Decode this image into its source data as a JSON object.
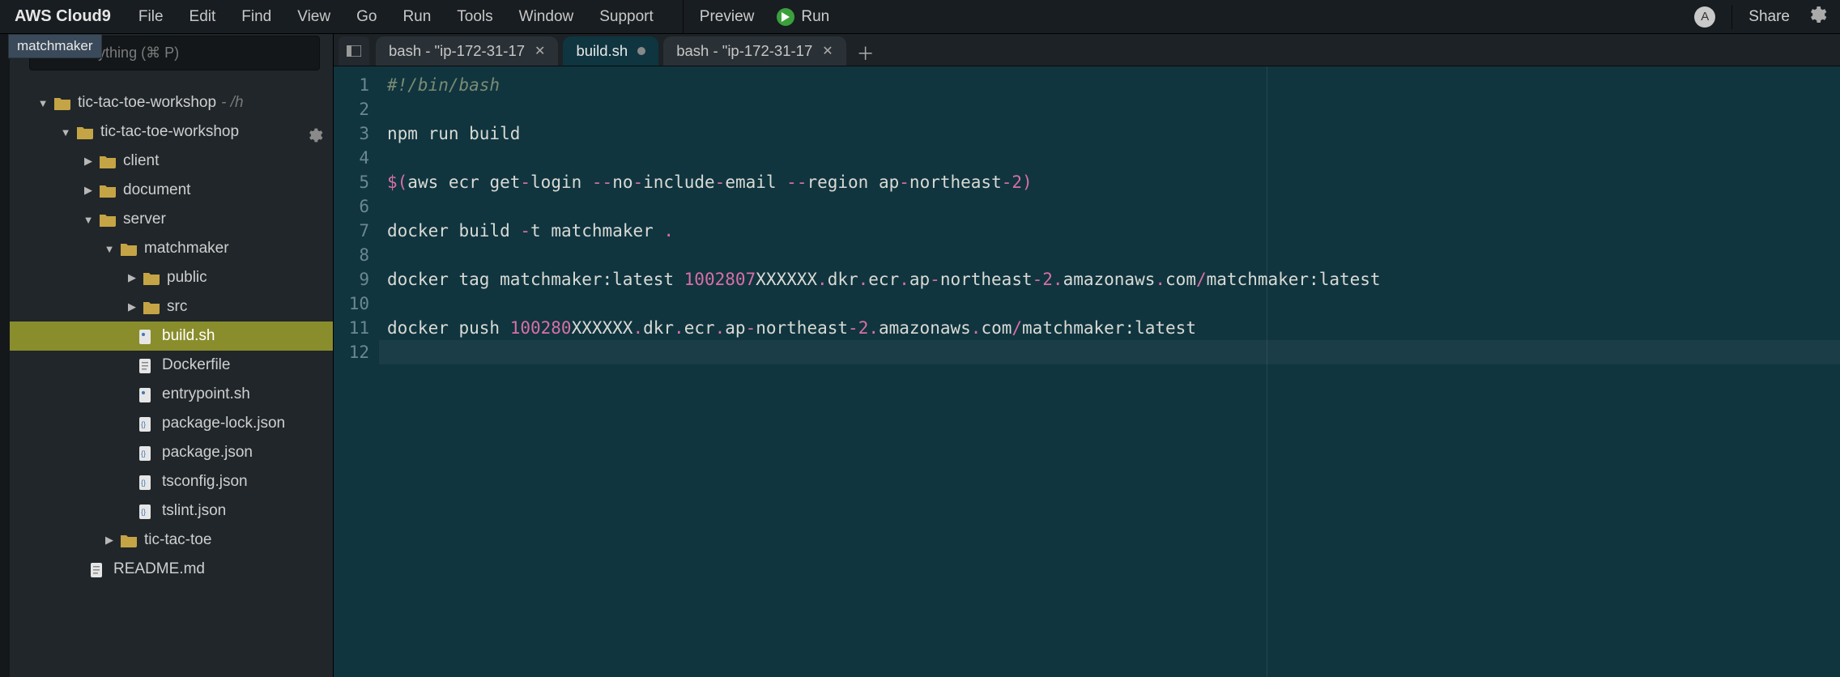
{
  "brand": "AWS Cloud9",
  "menu": [
    "File",
    "Edit",
    "Find",
    "View",
    "Go",
    "Run",
    "Tools",
    "Window",
    "Support"
  ],
  "preview_label": "Preview",
  "run_label": "Run",
  "avatar_letter": "A",
  "share_label": "Share",
  "tooltip": "matchmaker",
  "goto_placeholder": "Go to Anything (⌘ P)",
  "tree": {
    "root": {
      "name": "tic-tac-toe-workshop",
      "suffix": "- /h"
    },
    "workshop": "tic-tac-toe-workshop",
    "client": "client",
    "document": "document",
    "server": "server",
    "matchmaker": "matchmaker",
    "public": "public",
    "src": "src",
    "buildsh": "build.sh",
    "dockerfile": "Dockerfile",
    "entrypoint": "entrypoint.sh",
    "pkglock": "package-lock.json",
    "pkg": "package.json",
    "tsconfig": "tsconfig.json",
    "tslint": "tslint.json",
    "tictactoe": "tic-tac-toe",
    "readme": "README.md"
  },
  "tabs": {
    "t0": "bash - \"ip-172-31-17",
    "t1": "build.sh",
    "t2": "bash - \"ip-172-31-17"
  },
  "code": {
    "l1": "#!/bin/bash",
    "l3": "npm run build",
    "l5a": "$(",
    "l5b": "aws ecr get",
    "l5c": "-",
    "l5d": "login ",
    "l5e": "--",
    "l5f": "no",
    "l5g": "-",
    "l5h": "include",
    "l5i": "-",
    "l5j": "email ",
    "l5k": "--",
    "l5l": "region ap",
    "l5m": "-",
    "l5n": "northeast",
    "l5o": "-",
    "l5p": "2",
    "l5q": ")",
    "l7a": "docker build ",
    "l7b": "-",
    "l7c": "t matchmaker ",
    "l7d": ".",
    "l9a": "docker tag matchmaker:latest ",
    "l9b": "1002807",
    "l9c": "XXXXXX",
    "l9d": ".",
    "l9e": "dkr",
    "l9f": ".",
    "l9g": "ecr",
    "l9h": ".",
    "l9i": "ap",
    "l9j": "-",
    "l9k": "northeast",
    "l9l": "-",
    "l9m": "2.",
    "l9n": "amazonaws",
    "l9o": ".",
    "l9p": "com",
    "l9q": "/",
    "l9r": "matchmaker:latest",
    "l11a": "docker push ",
    "l11b": "100280",
    "l11c": "XXXXXX",
    "l11d": ".",
    "l11e": "dkr",
    "l11f": ".",
    "l11g": "ecr",
    "l11h": ".",
    "l11i": "ap",
    "l11j": "-",
    "l11k": "northeast",
    "l11l": "-",
    "l11m": "2.",
    "l11n": "amazonaws",
    "l11o": ".",
    "l11p": "com",
    "l11q": "/",
    "l11r": "matchmaker:latest"
  },
  "gutter": [
    "1",
    "2",
    "3",
    "4",
    "5",
    "6",
    "7",
    "8",
    "9",
    "10",
    "11",
    "12"
  ]
}
